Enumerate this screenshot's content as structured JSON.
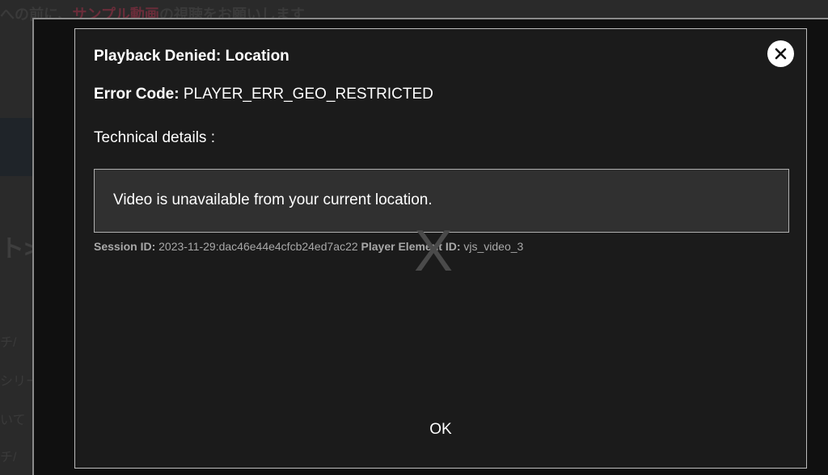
{
  "background": {
    "top_text_prefix": "への前に、",
    "top_text_link": "サンプル動画",
    "top_text_suffix": "の視聴をお願いします",
    "heading": "ト>",
    "lines": [
      "チ/",
      "シリー",
      "いて",
      "チ/"
    ]
  },
  "player": {
    "placeholder_glyph": "X"
  },
  "dialog": {
    "title": "Playback Denied: Location",
    "error_code_label": "Error Code:",
    "error_code_value": "PLAYER_ERR_GEO_RESTRICTED",
    "technical_details_label": "Technical details :",
    "message": "Video is unavailable from your current location.",
    "session_id_label": "Session ID:",
    "session_id_value": "2023-11-29:dac46e44e4cfcb24ed7ac22",
    "player_element_id_label": "Player Element ID:",
    "player_element_id_value": "vjs_video_3",
    "close_icon": "close-icon",
    "ok_label": "OK"
  },
  "colors": {
    "dialog_bg": "#1b1b1b",
    "message_box_bg": "#303030",
    "text": "#ffffff",
    "muted_text": "#a8a8a8"
  }
}
